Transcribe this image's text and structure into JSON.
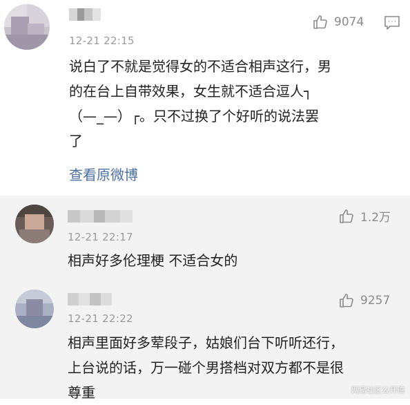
{
  "main_comment": {
    "time": "12-21 22:15",
    "like_count": "9074",
    "text_lines": [
      "说白了不就是觉得女的不适合相声这行，男",
      "的在台上自带效果，女生就不适合逗人┐",
      "（—_—）┌。只不过换了个好听的说法罢",
      "了"
    ],
    "view_original_label": "查看原微博"
  },
  "replies": [
    {
      "time": "12-21 22:17",
      "like_count": "1.2万",
      "text_lines": [
        "相声好多伦理梗  不适合女的"
      ]
    },
    {
      "time": "12-21 22:22",
      "like_count": "9257",
      "text_lines": [
        "相声里面好多荤段子，姑娘们台下听听还行，",
        "上台说的话，万一碰个男搭档对双方都不是很",
        "尊重"
      ]
    }
  ],
  "watermark": "网易社区公开稿",
  "icons": {
    "like": "thumb-up-icon",
    "comment": "comment-icon"
  }
}
